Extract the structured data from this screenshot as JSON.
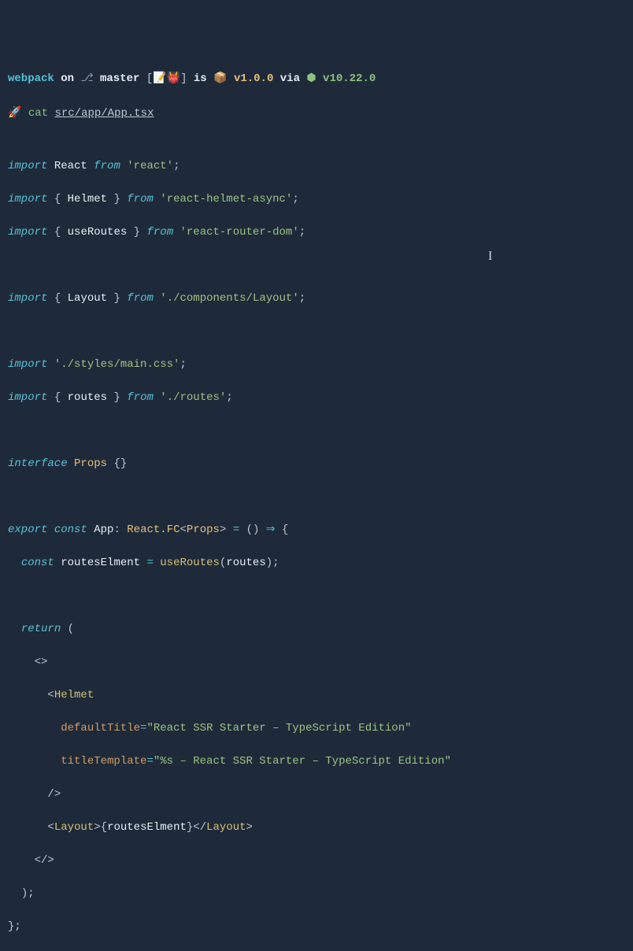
{
  "prompt": {
    "project": "webpack",
    "on_word": "on",
    "branch_icon": "⎇",
    "branch": "master",
    "status_emoji": "[📝👹]",
    "is_word": "is",
    "pkg_icon": "📦",
    "pkg_version": "v1.0.0",
    "via_word": "via",
    "node_icon": "⬢",
    "node_version": "v10.22.0",
    "rocket": "🚀",
    "command": "cat",
    "filepath": "src/app/App.tsx"
  },
  "code": {
    "l01_import": "import",
    "l01_def": "React",
    "l01_from": "from",
    "l01_str": "'react'",
    "l01_semi": ";",
    "l02_import": "import",
    "l02_brace_o": "{ ",
    "l02_def": "Helmet",
    "l02_brace_c": " }",
    "l02_from": "from",
    "l02_str": "'react-helmet-async'",
    "l02_semi": ";",
    "l03_import": "import",
    "l03_brace_o": "{ ",
    "l03_def": "useRoutes",
    "l03_brace_c": " }",
    "l03_from": "from",
    "l03_str": "'react-router-dom'",
    "l03_semi": ";",
    "l05_import": "import",
    "l05_brace_o": "{ ",
    "l05_def": "Layout",
    "l05_brace_c": " }",
    "l05_from": "from",
    "l05_str": "'./components/Layout'",
    "l05_semi": ";",
    "l07_import": "import",
    "l07_str": "'./styles/main.css'",
    "l07_semi": ";",
    "l08_import": "import",
    "l08_brace_o": "{ ",
    "l08_def": "routes",
    "l08_brace_c": " }",
    "l08_from": "from",
    "l08_str": "'./routes'",
    "l08_semi": ";",
    "l10_iface": "interface",
    "l10_name": "Props",
    "l10_body": "{}",
    "l12_export": "export",
    "l12_const": "const",
    "l12_name": "App",
    "l12_colon": ":",
    "l12_ns": "React",
    "l12_dot": ".",
    "l12_fc": "FC",
    "l12_lt": "<",
    "l12_props": "Props",
    "l12_gt": ">",
    "l12_eq": "=",
    "l12_paren": "()",
    "l12_arrow": "⇒",
    "l12_brace": "{",
    "l13_indent": "  ",
    "l13_const": "const",
    "l13_name": "routesElment",
    "l13_eq": "=",
    "l13_fn": "useRoutes",
    "l13_po": "(",
    "l13_arg": "routes",
    "l13_pc": ")",
    "l13_semi": ";",
    "l15_indent": "  ",
    "l15_return": "return",
    "l15_po": "(",
    "l16_indent": "    ",
    "l16_frag": "<>",
    "l17_indent": "      ",
    "l17_lt": "<",
    "l17_tag": "Helmet",
    "l18_indent": "        ",
    "l18_attr": "defaultTitle",
    "l18_eq": "=",
    "l18_val": "\"React SSR Starter – TypeScript Edition\"",
    "l19_indent": "        ",
    "l19_attr": "titleTemplate",
    "l19_eq": "=",
    "l19_val": "\"%s – React SSR Starter – TypeScript Edition\"",
    "l20_indent": "      ",
    "l20_close": "/>",
    "l21_indent": "      ",
    "l21_lt": "<",
    "l21_tag": "Layout",
    "l21_gt": ">",
    "l21_eo": "{",
    "l21_expr": "routesElment",
    "l21_ec": "}",
    "l21_clt": "</",
    "l21_ctag": "Layout",
    "l21_cgt": ">",
    "l22_indent": "    ",
    "l22_frag": "</>",
    "l23_indent": "  ",
    "l23_pc": ")",
    "l23_semi": ";",
    "l24_brace": "}",
    "l24_semi": ";"
  }
}
